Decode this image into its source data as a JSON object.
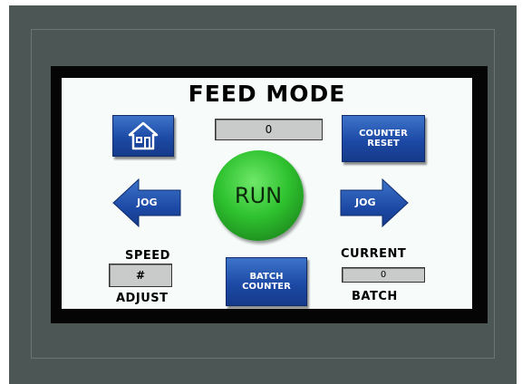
{
  "screen": {
    "title": "FEED MODE",
    "counter_display": "0",
    "home_icon": "home-icon",
    "counter_reset_label_1": "COUNTER",
    "counter_reset_label_2": "RESET",
    "run_label": "RUN",
    "jog_left_label": "JOG",
    "jog_right_label": "JOG",
    "speed_label": "SPEED",
    "speed_value": "#",
    "adjust_label": "ADJUST",
    "batch_counter_label_1": "BATCH",
    "batch_counter_label_2": "COUNTER",
    "current_label": "CURRENT",
    "current_value": "0",
    "batch_label": "BATCH"
  },
  "colors": {
    "bezel": "#4b5655",
    "button_blue": "#1d4aa6",
    "run_green": "#2fc22f",
    "screen_bg": "#f7fcfb"
  }
}
